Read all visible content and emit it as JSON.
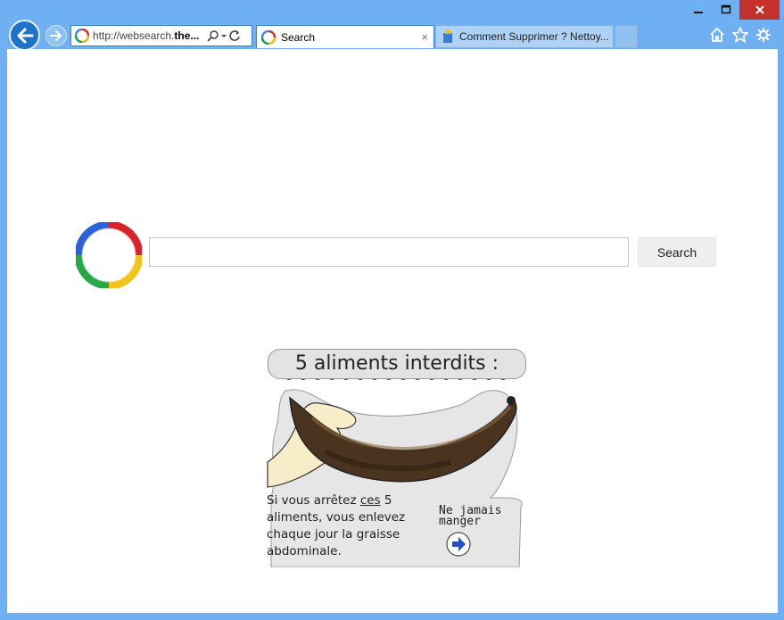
{
  "browser": {
    "address": {
      "prefix": "http://websearch.",
      "bold": "the..."
    },
    "tabs": [
      {
        "label": "Search",
        "active": true,
        "close": "×"
      },
      {
        "label": "Comment Supprimer ? Nettoy...",
        "active": false
      }
    ],
    "window_controls": {
      "minimize": "–",
      "maximize": "□",
      "close": "✕"
    },
    "icons": [
      "home-icon",
      "favorites-star-icon",
      "settings-gear-icon"
    ]
  },
  "search": {
    "button_label": "Search",
    "input_value": "",
    "placeholder": ""
  },
  "ad": {
    "title": "5 aliments interdits :",
    "text_line1_a": "Si vous arrêtez ",
    "text_line1_u": "ces",
    "text_line1_b": " 5",
    "text_rest": "aliments, vous enlevez chaque jour la graisse abdominale.",
    "cta": "Ne jamais manger"
  },
  "colors": {
    "frame": "#6eb0f2",
    "accent": "#1e72c8",
    "close": "#c7312b"
  }
}
